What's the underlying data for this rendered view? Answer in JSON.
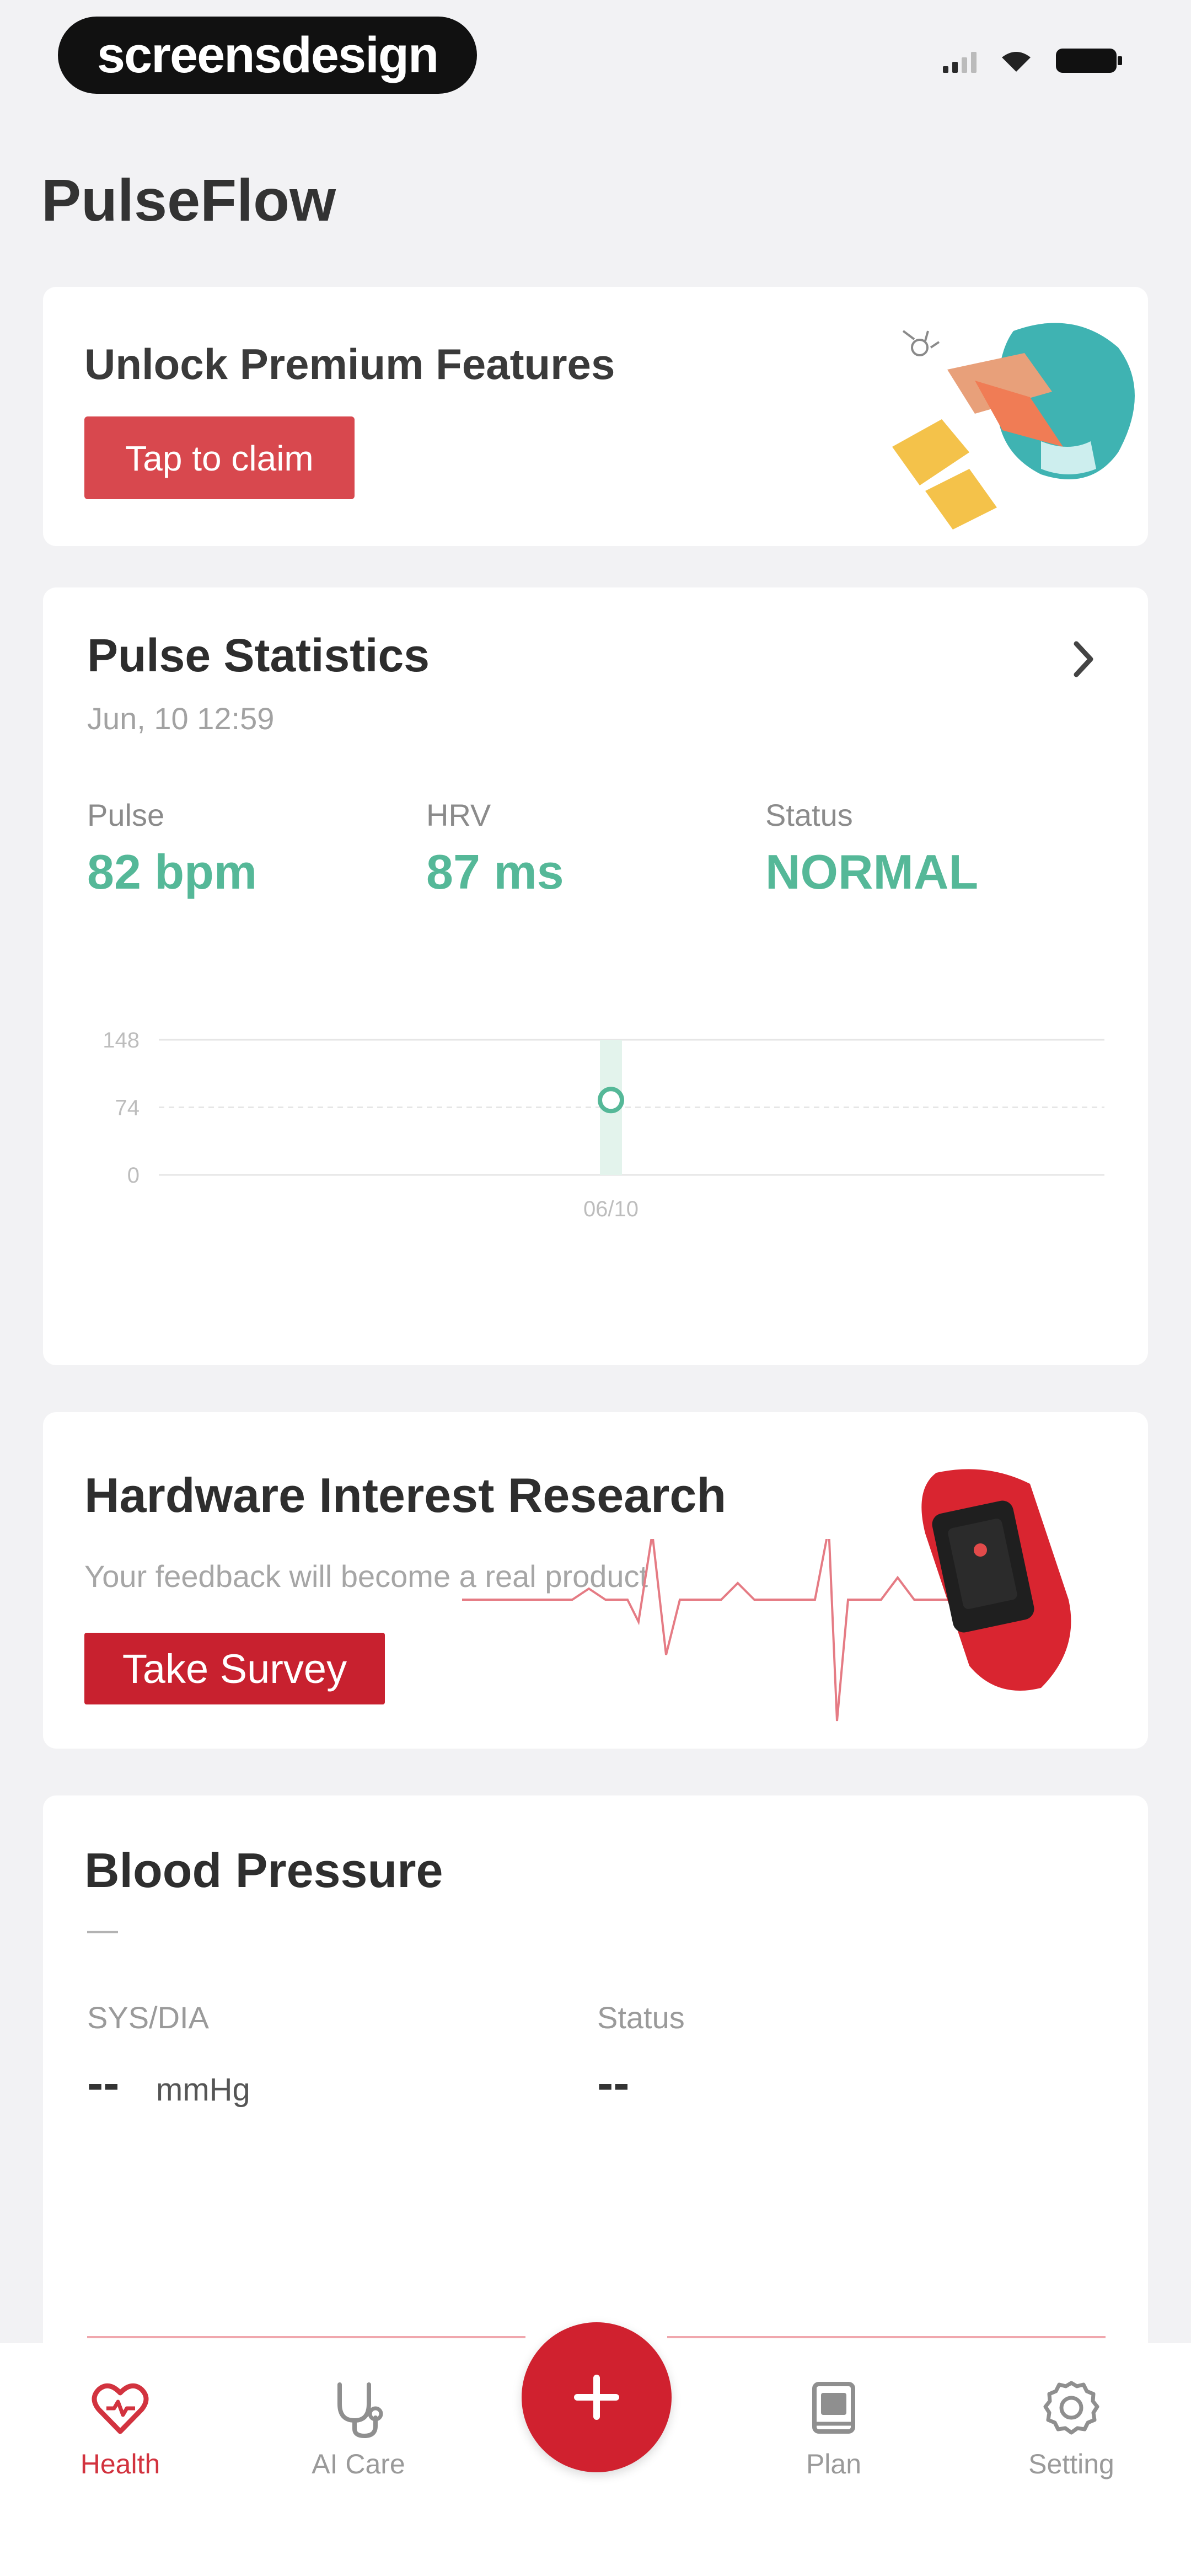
{
  "status_bar": {
    "brand": "screensdesign"
  },
  "app": {
    "title": "PulseFlow"
  },
  "promo": {
    "title": "Unlock Premium Features",
    "button": "Tap to claim"
  },
  "pulse": {
    "title": "Pulse Statistics",
    "date": "Jun, 10 12:59",
    "metrics": [
      {
        "label": "Pulse",
        "value": "82 bpm"
      },
      {
        "label": "HRV",
        "value": "87 ms"
      },
      {
        "label": "Status",
        "value": "NORMAL"
      }
    ],
    "accent_color": "#55b898"
  },
  "chart_data": {
    "type": "scatter",
    "title": "",
    "xlabel": "",
    "ylabel": "",
    "y_ticks": [
      "148",
      "74",
      "0"
    ],
    "ylim": [
      0,
      148
    ],
    "x_ticks": [
      "06/10"
    ],
    "points": [
      {
        "x": "06/10",
        "y": 82
      }
    ],
    "grid": true
  },
  "survey": {
    "title": "Hardware Interest Research",
    "subtitle": "Your feedback will become a real product",
    "button": "Take Survey"
  },
  "blood_pressure": {
    "title": "Blood Pressure",
    "time": "—",
    "sysdia_label": "SYS/DIA",
    "sysdia_value": "--",
    "unit": "mmHg",
    "status_label": "Status",
    "status_value": "--"
  },
  "tabbar": {
    "tabs": [
      {
        "label": "Health",
        "icon": "heart-icon",
        "active": true
      },
      {
        "label": "AI Care",
        "icon": "stethoscope-icon",
        "active": false
      },
      {
        "label": "Plan",
        "icon": "book-icon",
        "active": false
      },
      {
        "label": "Setting",
        "icon": "gear-icon",
        "active": false
      }
    ],
    "fab_icon": "plus-icon"
  },
  "colors": {
    "brand_red": "#d0212f",
    "green": "#55b898",
    "background": "#f2f2f4"
  }
}
